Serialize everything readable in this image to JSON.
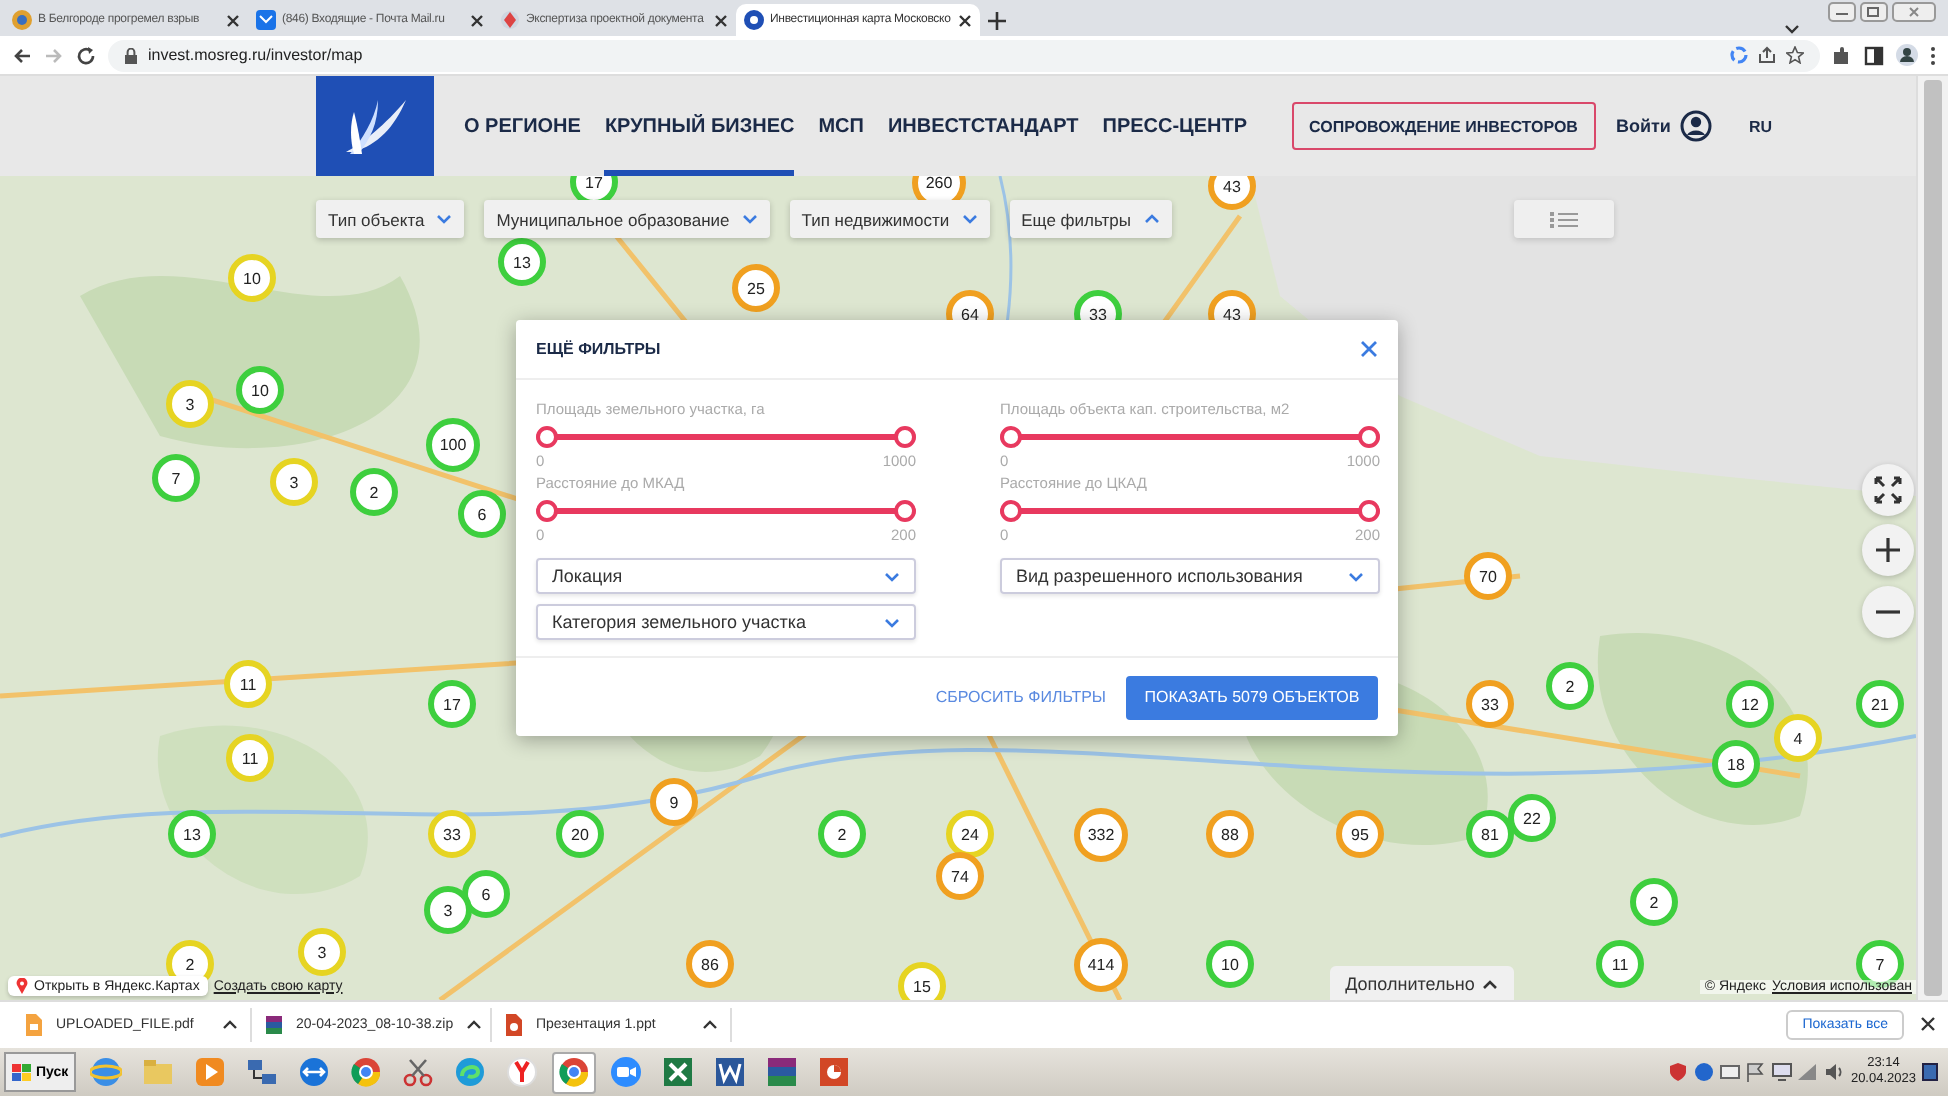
{
  "browser": {
    "tabs": [
      {
        "title": "В Белгороде прогремел взрыв",
        "selected": false
      },
      {
        "title": "(846) Входящие - Почта Mail.ru",
        "selected": false
      },
      {
        "title": "Экспертиза проектной документа",
        "selected": false
      },
      {
        "title": "Инвестиционная карта Московско",
        "selected": true
      }
    ],
    "address": "invest.mosreg.ru/investor/map"
  },
  "header": {
    "nav": [
      {
        "label": "О РЕГИОНЕ",
        "selected": false
      },
      {
        "label": "КРУПНЫЙ БИЗНЕС",
        "selected": true
      },
      {
        "label": "МСП",
        "selected": false
      },
      {
        "label": "ИНВЕСТСТАНДАРТ",
        "selected": false
      },
      {
        "label": "ПРЕСС-ЦЕНТР",
        "selected": false
      }
    ],
    "cta": "СОПРОВОЖДЕНИЕ ИНВЕСТОРОВ",
    "login": "Войти",
    "language": "RU"
  },
  "filters": [
    {
      "label": "Тип объекта",
      "expanded": false
    },
    {
      "label": "Муниципальное образование",
      "expanded": false
    },
    {
      "label": "Тип недвижимости",
      "expanded": false
    },
    {
      "label": "Еще фильтры",
      "expanded": true
    }
  ],
  "clusters": [
    {
      "count": "17",
      "color": "#3ecf3e"
    },
    {
      "count": "260",
      "color": "#f0a020"
    },
    {
      "count": "43",
      "color": "#f0a020"
    },
    {
      "count": "13",
      "color": "#3ecf3e"
    },
    {
      "count": "10",
      "color": "#e6d422"
    },
    {
      "count": "25",
      "color": "#f0a020"
    },
    {
      "count": "64",
      "color": "#f0a020"
    },
    {
      "count": "33",
      "color": "#3ecf3e"
    },
    {
      "count": "43",
      "color": "#f0a020"
    },
    {
      "count": "10",
      "color": "#3ecf3e"
    },
    {
      "count": "3",
      "color": "#e6d422"
    },
    {
      "count": "100",
      "color": "#3ecf3e"
    },
    {
      "count": "7",
      "color": "#3ecf3e"
    },
    {
      "count": "3",
      "color": "#e6d422"
    },
    {
      "count": "2",
      "color": "#3ecf3e"
    },
    {
      "count": "6",
      "color": "#3ecf3e"
    },
    {
      "count": "70",
      "color": "#f0a020"
    },
    {
      "count": "11",
      "color": "#e6d422"
    },
    {
      "count": "2",
      "color": "#3ecf3e"
    },
    {
      "count": "17",
      "color": "#3ecf3e"
    },
    {
      "count": "33",
      "color": "#f0a020"
    },
    {
      "count": "12",
      "color": "#3ecf3e"
    },
    {
      "count": "21",
      "color": "#3ecf3e"
    },
    {
      "count": "4",
      "color": "#e6d422"
    },
    {
      "count": "11",
      "color": "#e6d422"
    },
    {
      "count": "18",
      "color": "#3ecf3e"
    },
    {
      "count": "9",
      "color": "#f0a020"
    },
    {
      "count": "22",
      "color": "#3ecf3e"
    },
    {
      "count": "13",
      "color": "#3ecf3e"
    },
    {
      "count": "33",
      "color": "#e6d422"
    },
    {
      "count": "20",
      "color": "#3ecf3e"
    },
    {
      "count": "2",
      "color": "#3ecf3e"
    },
    {
      "count": "24",
      "color": "#e6d422"
    },
    {
      "count": "332",
      "color": "#f0a020"
    },
    {
      "count": "88",
      "color": "#f0a020"
    },
    {
      "count": "95",
      "color": "#f0a020"
    },
    {
      "count": "81",
      "color": "#3ecf3e"
    },
    {
      "count": "74",
      "color": "#f0a020"
    },
    {
      "count": "6",
      "color": "#3ecf3e"
    },
    {
      "count": "2",
      "color": "#3ecf3e"
    },
    {
      "count": "3",
      "color": "#3ecf3e"
    },
    {
      "count": "2",
      "color": "#e6d422"
    },
    {
      "count": "3",
      "color": "#e6d422"
    },
    {
      "count": "86",
      "color": "#f0a020"
    },
    {
      "count": "414",
      "color": "#f0a020"
    },
    {
      "count": "10",
      "color": "#3ecf3e"
    },
    {
      "count": "11",
      "color": "#3ecf3e"
    },
    {
      "count": "7",
      "color": "#3ecf3e"
    },
    {
      "count": "15",
      "color": "#e6d422"
    }
  ],
  "modal": {
    "title": "ЕЩЁ ФИЛЬТРЫ",
    "sliders": [
      {
        "label": "Площадь земельного участка, га",
        "min": "0",
        "max": "1000",
        "level": 1
      },
      {
        "label": "Площадь объекта кап. строительства, м2",
        "min": "0",
        "max": "1000",
        "level": 1
      },
      {
        "label": "Расстояние до МКАД",
        "min": "0",
        "max": "200",
        "level": 1
      },
      {
        "label": "Расстояние до ЦКАД",
        "min": "0",
        "max": "200",
        "level": 1
      }
    ],
    "selects": [
      "Локация",
      "Вид разрешенного использования",
      "Категория земельного участка"
    ],
    "reset": "СБРОСИТЬ ФИЛЬТРЫ",
    "submit": "ПОКАЗАТЬ 5079 ОБЪЕКТОВ"
  },
  "map_footer": {
    "open_link": "Открыть в Яндекс.Картах",
    "create_link": "Создать свою карту",
    "more": "Дополнительно",
    "copyright": "© Яндекс",
    "terms": "Условия использован"
  },
  "downloads": {
    "files": [
      "UPLOADED_FILE.pdf",
      "20-04-2023_08-10-38.zip",
      "Презентация 1.ppt"
    ],
    "show_all": "Показать все"
  },
  "taskbar": {
    "start": "Пуск",
    "time": "23:14",
    "date": "20.04.2023"
  }
}
